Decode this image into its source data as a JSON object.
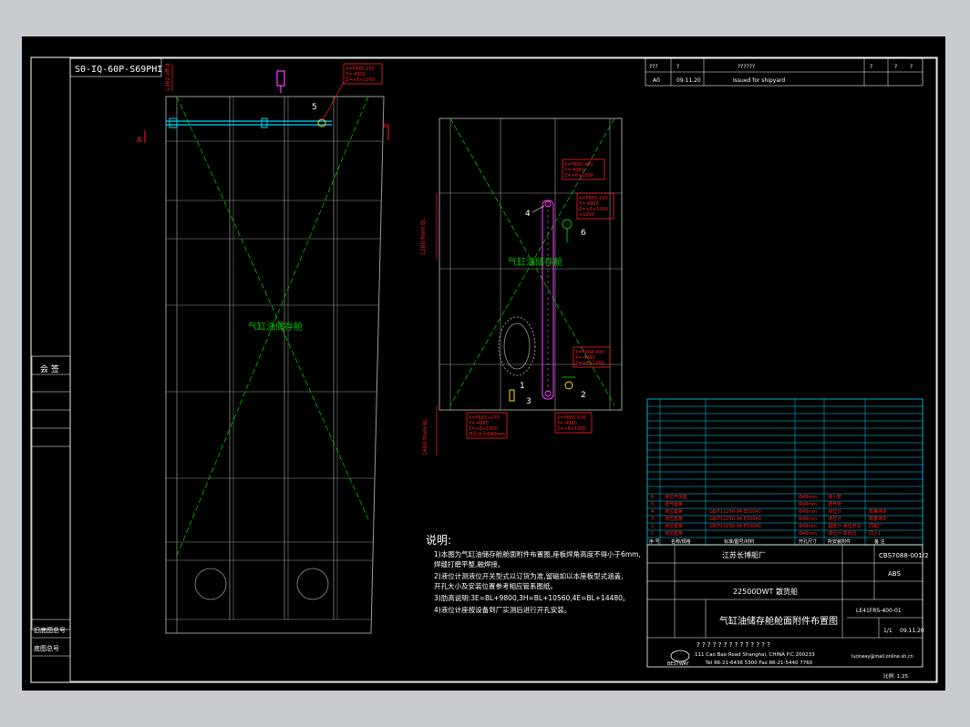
{
  "drawing": {
    "top_left_code": "S0-IQ-60P-S69PHI",
    "elev_label_top": "1392 off.4",
    "elev_label_mid": "1200 from BL",
    "elev_label_low": "1600 from BL",
    "section_mark_a": "A",
    "section_mark_b": "A"
  },
  "view_left": {
    "label": "气缸油储存舱",
    "callout": {
      "number": "5",
      "lines": [
        "X=FR65-250",
        "Y=-4900",
        "Z=+8+1000"
      ]
    }
  },
  "view_right": {
    "label": "气缸油储存舱",
    "callouts": [
      {
        "number": "4",
        "lines": [
          "X=FR65-400",
          "Y=-4980",
          "Z=+8+1000"
        ]
      },
      {
        "number": "6",
        "lines": [
          "X=FR65-250",
          "Y=-4900",
          "Z=+8+1000",
          "+1200"
        ]
      },
      {
        "number": "2",
        "lines": [
          "X=FR68-400",
          "Y=-4980",
          "Z=+8+1000"
        ]
      },
      {
        "number": "1",
        "lines": [
          "X=FR65+275",
          "Y=-4980",
          "Z=+8+1000",
          "开孔大小Φ40mm"
        ]
      },
      {
        "number": "3",
        "lines": [
          "X=FR65-500",
          "Y=-4980",
          "Z=+8+1000"
        ]
      }
    ]
  },
  "notes": {
    "title": "说明:",
    "lines": [
      "1)本图为气缸油储存舱舱面附件布置图,座板焊角高度不得小于6mm,",
      "  焊缝打磨平整,融焊接。",
      "2)液位计测液位开关型式以订货为准,留磁如以本座板型式涵盖,",
      "  开孔大小及安装位置参考相应管系图纸。",
      "3)肋高说明:3E=BL+9800,3H=BL+10560,4E=BL+14480。",
      "4)液位计座按设备到厂实测后进行开孔安装。"
    ]
  },
  "revision_block": {
    "header": [
      "???",
      "?",
      "?",
      "??????",
      "?",
      "?",
      "?"
    ],
    "row": [
      "A0",
      "09.11.20",
      "Issued for shipyard"
    ]
  },
  "left_strip": {
    "title": "会 签",
    "label_1": "旧底图总号",
    "label_2": "底图总号"
  },
  "parts_list": {
    "rows": [
      [
        "6",
        "液位开关座",
        "",
        "Φ48mm",
        "液入管",
        ""
      ],
      [
        "5",
        "透气座板",
        "",
        "Φ48mm",
        "透气管",
        ""
      ],
      [
        "4",
        "液位座板",
        "GB/T11256-94 E50040",
        "Φ48mm",
        "液位计",
        "数量待定"
      ],
      [
        "3",
        "液位座板",
        "GB/T11256-94 E50040",
        "Φ48mm",
        "液位计",
        "数量待定"
      ],
      [
        "2",
        "液位座板",
        "GB/T11256-94 E50040",
        "Φ48mm",
        "温度计 液位开关",
        "同船厂"
      ],
      [
        "1",
        "液位座板",
        "",
        "Φ48mm",
        "液位计 高低位",
        "同上1"
      ]
    ],
    "header": [
      "序 号",
      "名称/规格",
      "标准/图号/材料",
      "开孔尺寸",
      "所安装附件",
      "备 注"
    ]
  },
  "title_block": {
    "shipyard": "江苏长博船厂",
    "drawing_no": "CBS7088-001/2",
    "class": "ABS",
    "ship": "22500DWT 散货船",
    "title": "气缸油储存舱舱面附件布置图",
    "sheet_code": "LE41FRS-400-01",
    "sheet": "1/1",
    "date": "09.11.20",
    "qmarks_row": "? ? ? ? ? ? ? ? ? ? ? ? ? ?",
    "company": "BESTWAY",
    "address": "111 Cao Bao Road Shanghai, CHINA  P.C.200233",
    "contact": "Tel 86-21-6436 5300  Fax 86-21-5440 7760",
    "email": "luckway@mail.online.sh.cn",
    "scale_label": "比例: 1:25"
  },
  "colors": {
    "bg_outer": "#c8cbd0",
    "sheet": "#000000",
    "white": "#ffffff",
    "gray": "#9a9a9a",
    "green": "#00c000",
    "red": "#ff2020",
    "cyan": "#00d8ff",
    "magenta": "#ff40ff",
    "yellow": "#ffe000"
  }
}
